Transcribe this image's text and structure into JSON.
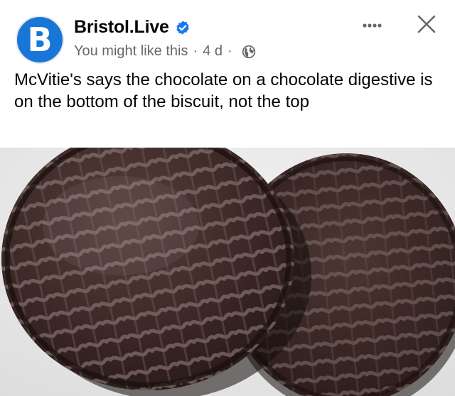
{
  "post": {
    "page_name": "Bristol.Live",
    "avatar_letter": "B",
    "meta": {
      "suggestion": "You might like this",
      "separator": "·",
      "age": "4 d",
      "audience_icon": "globe-icon"
    },
    "verified_icon": "verified-badge-icon",
    "more_icon": "more-options-icon",
    "close_icon": "close-icon",
    "text": "McVitie's says the chocolate on a chocolate digestive is on the bottom of the biscuit, not the top",
    "image": {
      "subject": "two chocolate digestive biscuits"
    }
  },
  "colors": {
    "avatar": "#1877d6",
    "verified": "#1877f2",
    "meta_text": "#65676b",
    "body_text": "#050505",
    "photo_background": "#e9e9e9",
    "chocolate": "#3a2523"
  }
}
